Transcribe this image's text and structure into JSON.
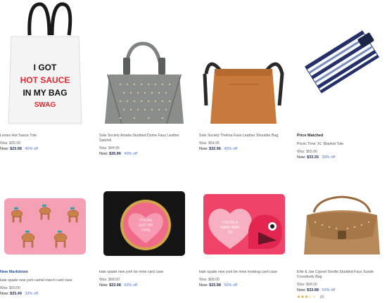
{
  "products": [
    {
      "name": "Levtex Hot Sauce Tote",
      "was": "Was: $39.99",
      "now_label": "Now:",
      "now_price": "$23.98",
      "off": "40% off",
      "tote_text": [
        "I GOT",
        "HOT SAUCE",
        "IN MY BAG",
        "SWAG"
      ]
    },
    {
      "name": "Sole Society Amalia Studded Dome Faux Leather Satchel",
      "was": "Was: $44.95",
      "now_label": "Now:",
      "now_price": "$26.96",
      "off": "40% off"
    },
    {
      "name": "Sole Society Thelma Faux Leather Shoulder Bag",
      "was": "Was: $54.95",
      "now_label": "Now:",
      "now_price": "$32.96",
      "off": "40% off"
    },
    {
      "badge": "Price Matched",
      "name": "Picnic Time 'XL' Blanket Tote",
      "was": "Was: $55.00",
      "now_label": "Now:",
      "now_price": "$33.35",
      "off": "39% off"
    },
    {
      "badge": "New Markdown",
      "name": "kate spade new york camel march card case",
      "was": "Was: $50.00",
      "now_label": "Now:",
      "now_price": "$33.49",
      "off": "33% off"
    },
    {
      "name": "kate spade new york be mine card case",
      "was": "Was: $68.00",
      "now_label": "Now:",
      "now_price": "$33.98",
      "off": "50% off",
      "heart_text": [
        "YOU'RE",
        "JUST MY",
        "TYPE"
      ]
    },
    {
      "name": "kate spade new york be mine lovebug card case",
      "was": "Was: $68.00",
      "now_label": "Now:",
      "now_price": "$33.98",
      "off": "50% off",
      "heart_text": [
        "YOU'RE A",
        "RARE BIRD",
        "XO"
      ]
    },
    {
      "name": "Ellie & Jae Cypset Sevilla Studded Faux Suede Crossbody Bag",
      "was": "Was: $68.00",
      "now_label": "Now:",
      "now_price": "$33.98",
      "off": "50% off",
      "stars": "★★★☆☆",
      "review_count": "(8)"
    }
  ],
  "colors": {
    "price_blue": "#1e2a55",
    "discount_blue": "#4a72c8",
    "markdown_blue": "#2453a6",
    "tote_red": "#e8262f",
    "kate_pink": "#f06a8a",
    "camel_pink": "#f5a0b4",
    "blanket_navy": "#24306a",
    "cognac": "#c87a3c"
  }
}
